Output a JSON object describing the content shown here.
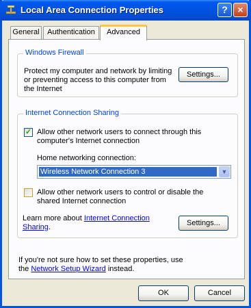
{
  "window": {
    "title": "Local Area Connection Properties",
    "help_label": "?",
    "close_label": "×"
  },
  "tabs": [
    {
      "label": "General"
    },
    {
      "label": "Authentication"
    },
    {
      "label": "Advanced",
      "selected": true
    }
  ],
  "firewall": {
    "group_title": "Windows Firewall",
    "desc_line1": "Protect my computer and network by limiting",
    "desc_line2": "or preventing access to this computer from",
    "desc_line3": "the Internet",
    "settings_label": "Settings..."
  },
  "ics": {
    "group_title": "Internet Connection Sharing",
    "allow_connect_line1": "Allow other network users to connect through this",
    "allow_connect_line2": "computer's Internet connection",
    "allow_connect_checked": true,
    "home_network_label": "Home networking connection:",
    "home_network_value": "Wireless Network Connection 3",
    "allow_control_line1": "Allow other network users to control or disable the",
    "allow_control_line2": "shared Internet connection",
    "allow_control_checked": false,
    "learn_prefix": "Learn more about ",
    "learn_link_line1": "Internet Connection",
    "learn_link_line2": "Sharing",
    "learn_suffix": ".",
    "settings_label": "Settings..."
  },
  "footer": {
    "line1": "If you're not sure how to set these properties, use",
    "line2_prefix": "the ",
    "wizard_link": "Network Setup Wizard",
    "line2_suffix": " instead."
  },
  "buttons": {
    "ok_label": "OK",
    "cancel_label": "Cancel"
  }
}
